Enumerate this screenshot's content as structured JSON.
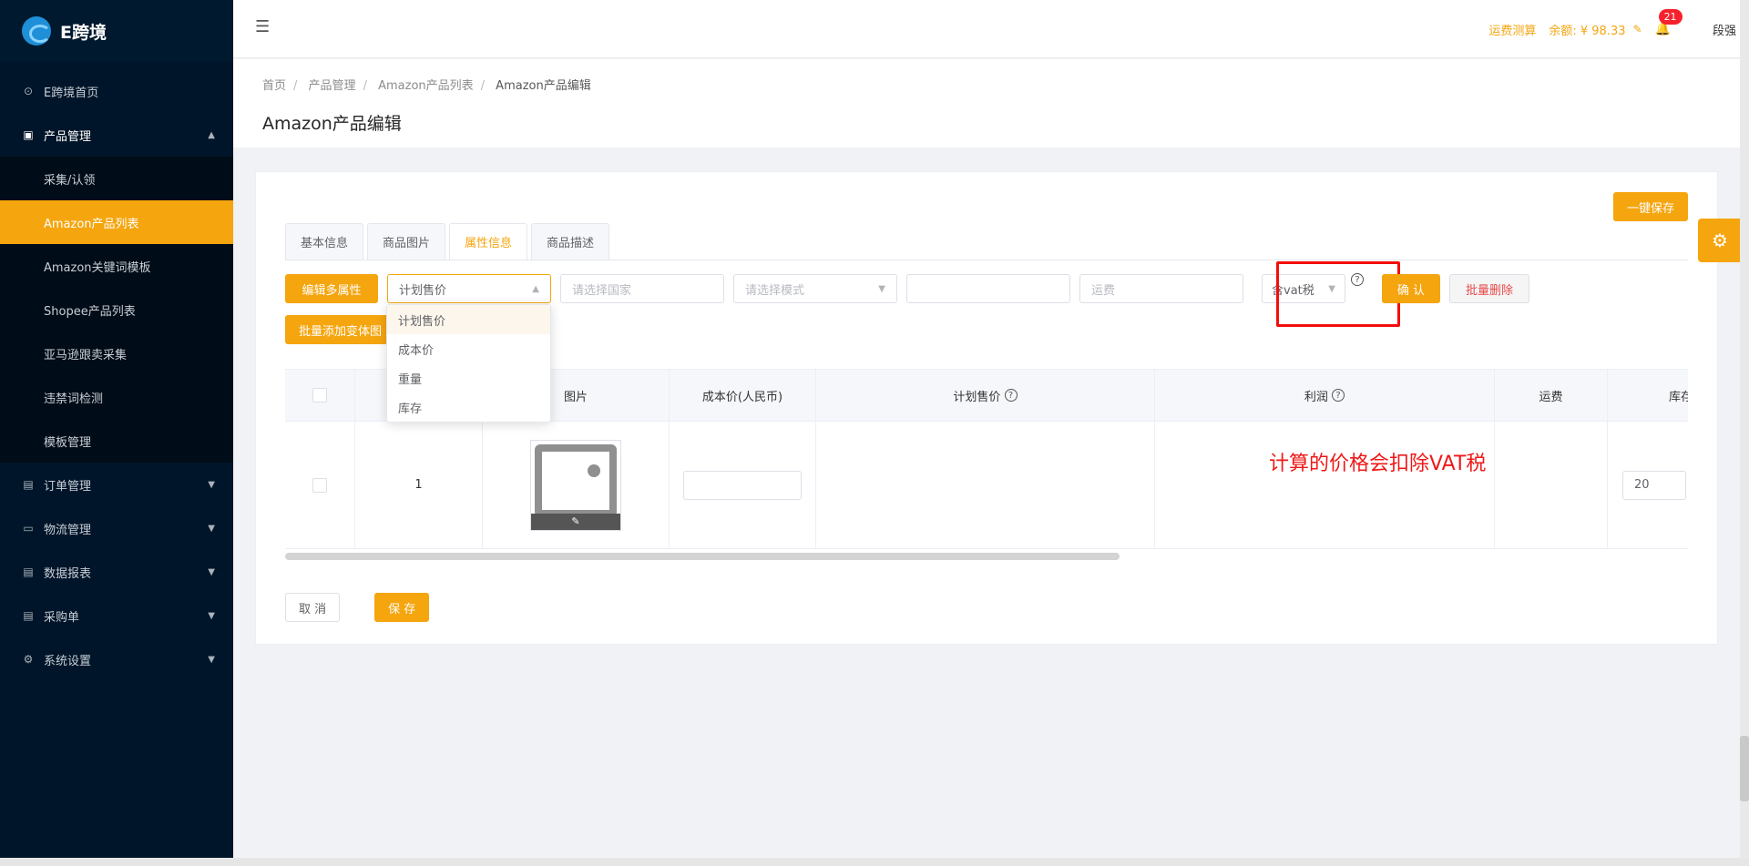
{
  "app": {
    "logo_text": "E跨境"
  },
  "sidebar": {
    "items": [
      {
        "label": "E跨境首页",
        "icon": "dashboard-icon"
      },
      {
        "label": "产品管理",
        "icon": "product-icon",
        "open": true,
        "children": [
          "采集/认领",
          "Amazon产品列表",
          "Amazon关键词模板",
          "Shopee产品列表",
          "亚马逊跟卖采集",
          "违禁词检测",
          "模板管理"
        ],
        "active_child": "Amazon产品列表"
      },
      {
        "label": "订单管理",
        "icon": "order-icon"
      },
      {
        "label": "物流管理",
        "icon": "truck-icon"
      },
      {
        "label": "数据报表",
        "icon": "report-icon"
      },
      {
        "label": "采购单",
        "icon": "purchase-icon"
      },
      {
        "label": "系统设置",
        "icon": "gear-icon"
      }
    ]
  },
  "header": {
    "freight_calc": "运费测算",
    "balance": "余额: ¥ 98.33",
    "notif_count": "21",
    "user": "段强"
  },
  "breadcrumb": [
    "首页",
    "产品管理",
    "Amazon产品列表",
    "Amazon产品编辑"
  ],
  "page_title": "Amazon产品编辑",
  "card": {
    "save_all": "一键保存",
    "tabs": [
      "基本信息",
      "商品图片",
      "属性信息",
      "商品描述"
    ],
    "active_tab": "属性信息",
    "toolbar": {
      "edit_multi": "编辑多属性",
      "attr_select": "计划售价",
      "country_placeholder": "请选择国家",
      "mode_placeholder": "请选择模式",
      "value_input": "",
      "freight_placeholder": "运费",
      "vat_select": "含vat税",
      "confirm": "确 认",
      "batch_delete": "批量删除",
      "batch_add_variant": "批量添加变体图"
    },
    "dropdown_options": [
      "计划售价",
      "成本价",
      "重量",
      "库存"
    ],
    "vat_note": "计算的价格会扣除VAT税",
    "table": {
      "headers": [
        "",
        "",
        "图片",
        "成本价(人民币)",
        "计划售价",
        "利润",
        "运费",
        "库存"
      ],
      "rows": [
        {
          "index": "1",
          "cost": "",
          "stock": "20"
        }
      ]
    },
    "cancel": "取 消",
    "save": "保 存"
  },
  "colors": {
    "accent": "#f5a50e",
    "sidebar_bg": "#001529",
    "annotation_red": "#f30d0d"
  }
}
